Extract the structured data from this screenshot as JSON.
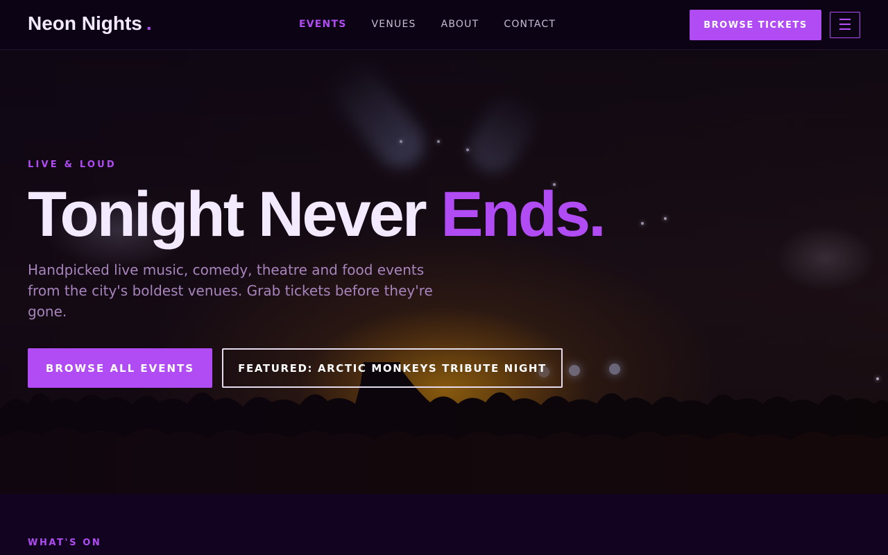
{
  "brand": {
    "name": "Neon Nights",
    "dot": ".",
    "accent_color": "#b14cf5"
  },
  "nav": {
    "items": [
      {
        "label": "EVENTS",
        "active": true
      },
      {
        "label": "VENUES",
        "active": false
      },
      {
        "label": "ABOUT",
        "active": false
      },
      {
        "label": "CONTACT",
        "active": false
      }
    ],
    "cta_label": "BROWSE TICKETS",
    "menu_icon": "hamburger-menu-icon",
    "menu_glyph": "☰"
  },
  "hero": {
    "background": "concert-crowd-photo",
    "eyebrow": "LIVE & LOUD",
    "title_main": "Tonight Never ",
    "title_accent": "Ends.",
    "subtitle": "Handpicked live music, comedy, theatre and food events from the city's boldest venues. Grab tickets before they're gone.",
    "primary_button": "BROWSE ALL EVENTS",
    "secondary_button": "FEATURED: ARCTIC MONKEYS TRIBUTE NIGHT"
  },
  "section": {
    "eyebrow": "WHAT'S ON"
  },
  "colors": {
    "background": "#0f0418",
    "header": "#0c0414",
    "accent": "#b14cf5",
    "text": "#f3eaff",
    "muted": "#a884bd"
  }
}
